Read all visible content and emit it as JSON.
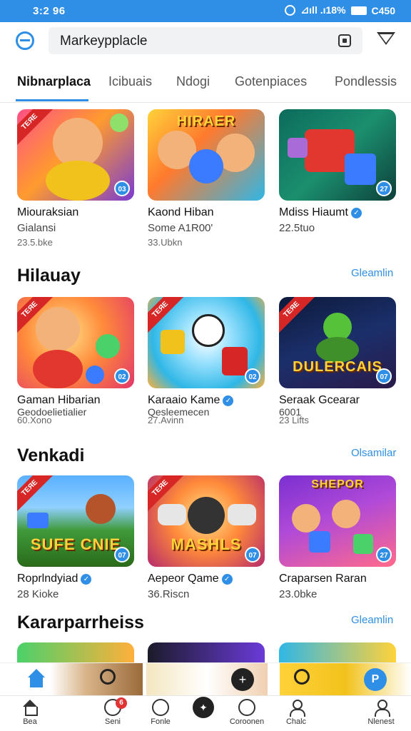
{
  "status_bar": {
    "time": "3:2 96",
    "right_text": "⊿ıll .ı18%",
    "battery_text": "C450"
  },
  "search": {
    "value": "Markeypplacle"
  },
  "tabs": [
    {
      "label": "Nibnarplaca",
      "active": true
    },
    {
      "label": "Icibuais",
      "active": false
    },
    {
      "label": "Ndogi",
      "active": false
    },
    {
      "label": "Gotenpiaces",
      "active": false
    },
    {
      "label": "Pondlessis",
      "active": false
    }
  ],
  "sections": [
    {
      "title": "",
      "see_all": "",
      "cards": [
        {
          "title": "Miouraksian",
          "subtitle": "Gialansi",
          "meta": "23.5.bke",
          "verified": false,
          "ribbon": "ТЕЯЕ",
          "badge": "03",
          "logo": ""
        },
        {
          "title": "Kaond Hiban",
          "subtitle": "Some A1R00'",
          "meta": "33.Ubkn",
          "verified": false,
          "ribbon": "",
          "badge": "",
          "logo": "HIRAER"
        },
        {
          "title": "Mdiss Hiaumt",
          "subtitle": "22.5tuo",
          "meta": "",
          "verified": true,
          "ribbon": "",
          "badge": "27",
          "logo": ""
        }
      ]
    },
    {
      "title": "Hilauay",
      "see_all": "Gleamlin",
      "cards": [
        {
          "title": "Gaman Hibarian",
          "subtitle": "Geodoelietialier",
          "meta": "60.Xono",
          "verified": false,
          "ribbon": "ТЕЯЕ",
          "badge": "02",
          "logo": ""
        },
        {
          "title": "Karaaio Kame",
          "subtitle": "Qesleemecen",
          "meta": "27.Avinn",
          "verified": true,
          "ribbon": "ТЕЯЕ",
          "badge": "02",
          "logo": ""
        },
        {
          "title": "Seraak Gcearar",
          "subtitle": "6001",
          "meta": "23 Lifts",
          "verified": false,
          "ribbon": "ТЕЯЕ",
          "badge": "07",
          "logo": "DULERCAIS"
        }
      ]
    },
    {
      "title": "Venkadi",
      "see_all": "Olsamilar",
      "cards": [
        {
          "title": "Roprlndyiad",
          "subtitle": "28 Kioke",
          "meta": "",
          "verified": true,
          "ribbon": "ТЕЯЕ",
          "badge": "07",
          "logo": "SUFE CNIE"
        },
        {
          "title": "Aepeor Qame",
          "subtitle": "36.Riscn",
          "meta": "",
          "verified": true,
          "ribbon": "ТЕЯЕ",
          "badge": "07",
          "logo": "MASHLS"
        },
        {
          "title": "Craparsen Raran",
          "subtitle": "23.0bke",
          "meta": "",
          "verified": false,
          "ribbon": "",
          "badge": "27",
          "logo": "SHEPOR"
        }
      ]
    },
    {
      "title": "Kararparrheiss",
      "see_all": "Gleamlin",
      "cards": []
    }
  ],
  "bottom_strip": {
    "center_badge": "0",
    "p_label": "P",
    "plus_label": "+"
  },
  "nav": [
    {
      "label": "Bea",
      "icon": "home-icon"
    },
    {
      "label": "Seni",
      "icon": "chat-icon",
      "badge": "6"
    },
    {
      "label": "Fonle",
      "icon": "search-icon"
    },
    {
      "label": "",
      "icon": "center-action-icon"
    },
    {
      "label": "Coroonen",
      "icon": "smile-icon"
    },
    {
      "label": "Chalc",
      "icon": "user-icon"
    },
    {
      "label": "Nlenest",
      "icon": "profile-icon"
    }
  ],
  "colors": {
    "accent": "#2f8fe6",
    "ribbon": "#d72626",
    "logo_yellow": "#ffd23a"
  }
}
